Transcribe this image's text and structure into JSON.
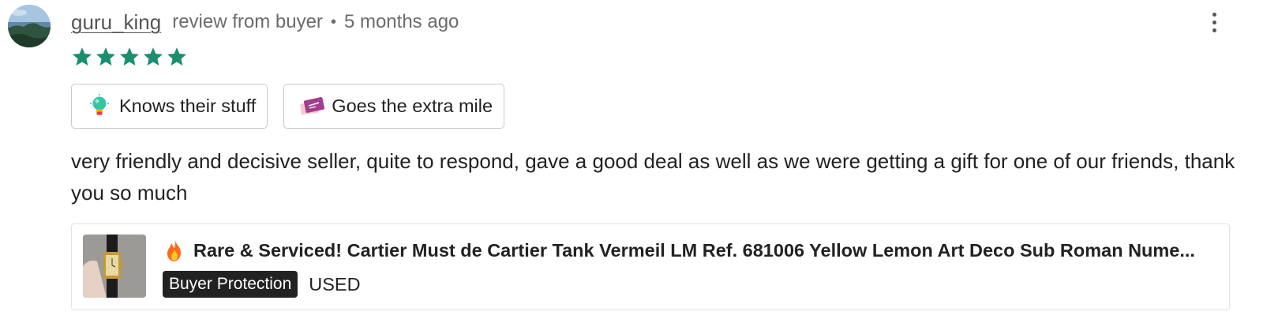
{
  "review": {
    "username": "guru_king",
    "role": "review from buyer",
    "separator": "•",
    "time_ago": "5 months ago",
    "rating": 5,
    "star_color": "#1a8f6f",
    "tags": [
      {
        "label": "Knows their stuff",
        "icon": "lightbulb-icon"
      },
      {
        "label": "Goes the extra mile",
        "icon": "ticket-icon"
      }
    ],
    "text": "very friendly and decisive seller, quite to respond, gave a good deal as well as we were getting a gift for one of our friends, thank you so much",
    "more_icon": "more-vertical-icon"
  },
  "product": {
    "title_icon": "fire-icon",
    "title": "Rare & Serviced! Cartier Must de Cartier Tank Vermeil LM Ref. 681006 Yellow Lemon Art Deco Sub Roman Nume...",
    "badge": "Buyer Protection",
    "condition": "USED",
    "thumbnail": "watch-thumbnail"
  }
}
